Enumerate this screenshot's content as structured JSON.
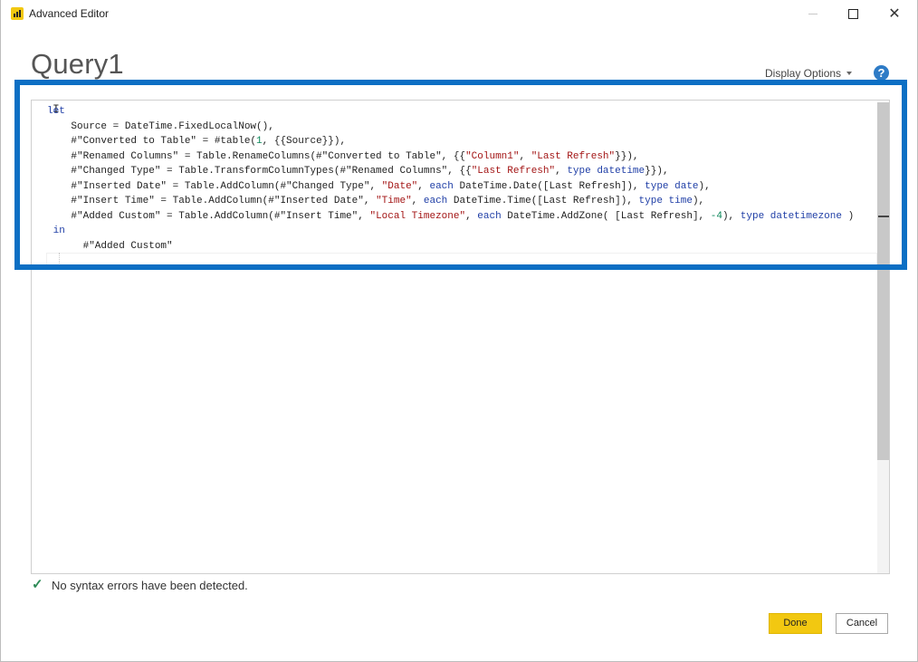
{
  "window": {
    "title": "Advanced Editor",
    "close_glyph": "✕",
    "minimize_icon": "minimize-icon",
    "maximize_icon": "maximize-icon"
  },
  "header": {
    "query_name": "Query1",
    "display_options": "Display Options",
    "help_glyph": "?"
  },
  "editor": {
    "lines": [
      [
        {
          "t": "let",
          "c": "kw"
        }
      ],
      [
        {
          "t": "    Source = DateTime.FixedLocalNow(),",
          "c": ""
        }
      ],
      [
        {
          "t": "    #\"Converted to Table\" = #table(",
          "c": ""
        },
        {
          "t": "1",
          "c": "num"
        },
        {
          "t": ", {{Source}}),",
          "c": ""
        }
      ],
      [
        {
          "t": "    #\"Renamed Columns\" = Table.RenameColumns(#\"Converted to Table\", {{",
          "c": ""
        },
        {
          "t": "\"Column1\"",
          "c": "str"
        },
        {
          "t": ", ",
          "c": ""
        },
        {
          "t": "\"Last Refresh\"",
          "c": "str"
        },
        {
          "t": "}}),",
          "c": ""
        }
      ],
      [
        {
          "t": "    #\"Changed Type\" = Table.TransformColumnTypes(#\"Renamed Columns\", {{",
          "c": ""
        },
        {
          "t": "\"Last Refresh\"",
          "c": "str"
        },
        {
          "t": ", ",
          "c": ""
        },
        {
          "t": "type datetime",
          "c": "kw"
        },
        {
          "t": "}}),",
          "c": ""
        }
      ],
      [
        {
          "t": "    #\"Inserted Date\" = Table.AddColumn(#\"Changed Type\", ",
          "c": ""
        },
        {
          "t": "\"Date\"",
          "c": "str"
        },
        {
          "t": ", ",
          "c": ""
        },
        {
          "t": "each",
          "c": "kw"
        },
        {
          "t": " DateTime.Date([Last Refresh]), ",
          "c": ""
        },
        {
          "t": "type date",
          "c": "kw"
        },
        {
          "t": "),",
          "c": ""
        }
      ],
      [
        {
          "t": "    #\"Insert Time\" = Table.AddColumn(#\"Inserted Date\", ",
          "c": ""
        },
        {
          "t": "\"Time\"",
          "c": "str"
        },
        {
          "t": ", ",
          "c": ""
        },
        {
          "t": "each",
          "c": "kw"
        },
        {
          "t": " DateTime.Time([Last Refresh]), ",
          "c": ""
        },
        {
          "t": "type time",
          "c": "kw"
        },
        {
          "t": "),",
          "c": ""
        }
      ],
      [
        {
          "t": "    #\"Added Custom\" = Table.AddColumn(#\"Insert Time\", ",
          "c": ""
        },
        {
          "t": "\"Local Timezone\"",
          "c": "str"
        },
        {
          "t": ", ",
          "c": ""
        },
        {
          "t": "each",
          "c": "kw"
        },
        {
          "t": " DateTime.AddZone( [Last Refresh], ",
          "c": ""
        },
        {
          "t": "-4",
          "c": "num"
        },
        {
          "t": "), ",
          "c": ""
        },
        {
          "t": "type datetimezone",
          "c": "kw"
        },
        {
          "t": " )",
          "c": ""
        }
      ],
      [
        {
          "t": " in",
          "c": "kw"
        }
      ],
      [
        {
          "t": "      #\"Added Custom\"",
          "c": ""
        }
      ]
    ]
  },
  "status": {
    "message": "No syntax errors have been detected.",
    "icon": "check-icon"
  },
  "buttons": {
    "done": "Done",
    "cancel": "Cancel"
  },
  "colors": {
    "accent_highlight": "#0c6fc4",
    "done_button": "#f2c811",
    "keyword": "#1f3ea6",
    "string": "#a31515",
    "number": "#098658"
  }
}
